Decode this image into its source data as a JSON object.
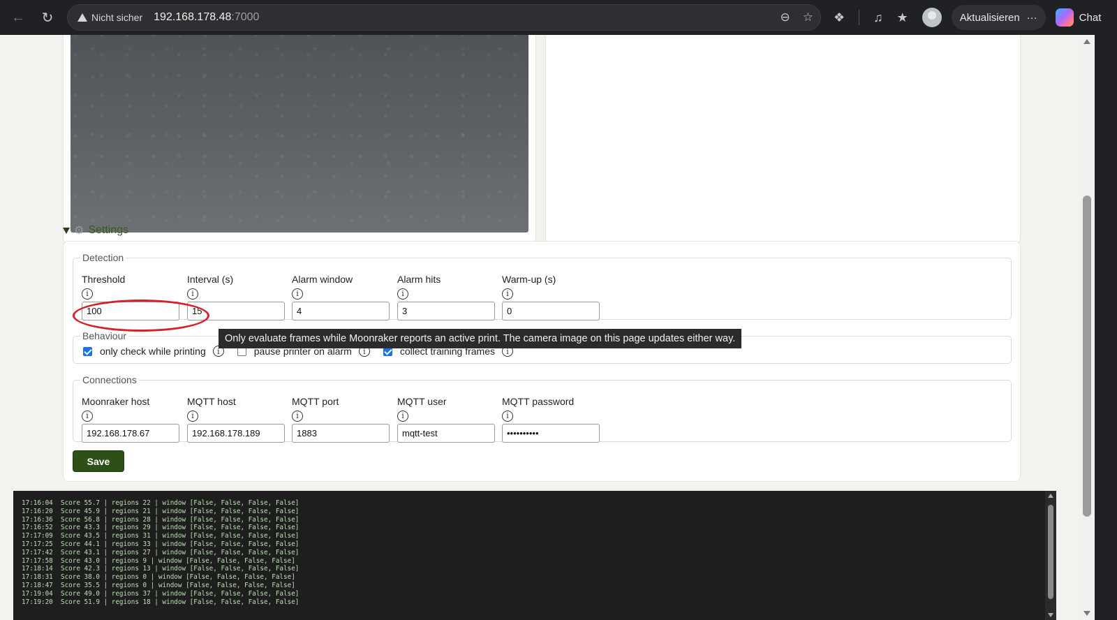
{
  "browser": {
    "security_label": "Nicht sicher",
    "url_host": "192.168.178.48",
    "url_port": ":7000",
    "update_label": "Aktualisieren",
    "more_label": "···",
    "chat_label": "Chat"
  },
  "settings": {
    "summary_label": "Settings",
    "detection": {
      "legend": "Detection",
      "fields": [
        {
          "label": "Threshold",
          "value": "100"
        },
        {
          "label": "Interval (s)",
          "value": "15"
        },
        {
          "label": "Alarm window",
          "value": "4"
        },
        {
          "label": "Alarm hits",
          "value": "3"
        },
        {
          "label": "Warm-up (s)",
          "value": "0"
        }
      ]
    },
    "behaviour": {
      "legend": "Behaviour",
      "options": [
        {
          "label": "only check while printing",
          "checked": true
        },
        {
          "label": "pause printer on alarm",
          "checked": false
        },
        {
          "label": "collect training frames",
          "checked": true
        }
      ]
    },
    "connections": {
      "legend": "Connections",
      "fields": [
        {
          "label": "Moonraker host",
          "value": "192.168.178.67"
        },
        {
          "label": "MQTT host",
          "value": "192.168.178.189"
        },
        {
          "label": "MQTT port",
          "value": "1883"
        },
        {
          "label": "MQTT user",
          "value": "mqtt-test"
        },
        {
          "label": "MQTT password",
          "value": "••••••••••"
        }
      ]
    },
    "save_label": "Save",
    "info_glyph": "i"
  },
  "tooltip": "Only evaluate frames while Moonraker reports an active print. The camera image on this page updates either way.",
  "log": [
    "17:16:04  Score 55.7 | regions 22 | window [False, False, False, False]",
    "17:16:20  Score 45.9 | regions 21 | window [False, False, False, False]",
    "17:16:36  Score 56.8 | regions 28 | window [False, False, False, False]",
    "17:16:52  Score 43.3 | regions 29 | window [False, False, False, False]",
    "17:17:09  Score 43.5 | regions 31 | window [False, False, False, False]",
    "17:17:25  Score 44.1 | regions 33 | window [False, False, False, False]",
    "17:17:42  Score 43.1 | regions 27 | window [False, False, False, False]",
    "17:17:58  Score 43.0 | regions 9 | window [False, False, False, False]",
    "17:18:14  Score 42.3 | regions 13 | window [False, False, False, False]",
    "17:18:31  Score 38.0 | regions 0 | window [False, False, False, False]",
    "17:18:47  Score 35.5 | regions 0 | window [False, False, False, False]",
    "17:19:04  Score 49.0 | regions 37 | window [False, False, False, False]",
    "17:19:20  Score 51.9 | regions 18 | window [False, False, False, False]"
  ]
}
